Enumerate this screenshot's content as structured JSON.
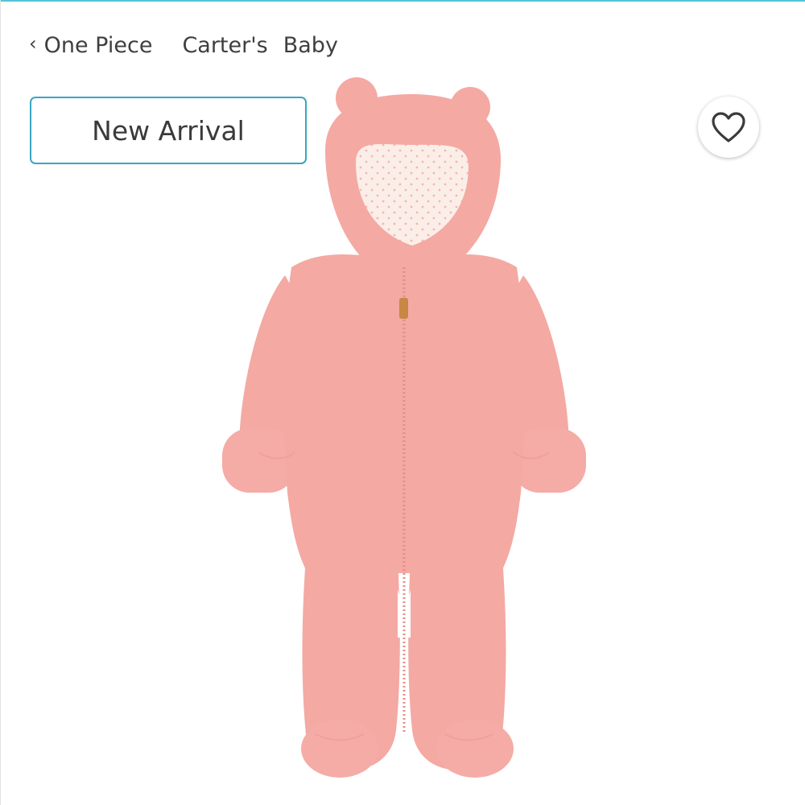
{
  "breadcrumb": {
    "back_chevron": "‹",
    "category": "One Piece",
    "brand": "Carter's",
    "size": "Baby"
  },
  "badge": {
    "label": "New Arrival"
  },
  "icons": {
    "back": "chevron-left-icon",
    "like": "heart-icon"
  },
  "colors": {
    "accent": "#3aa6c3",
    "top_bar": "#56c3d6",
    "product_pink": "#f4a9a3",
    "product_lining": "#fbece6"
  }
}
